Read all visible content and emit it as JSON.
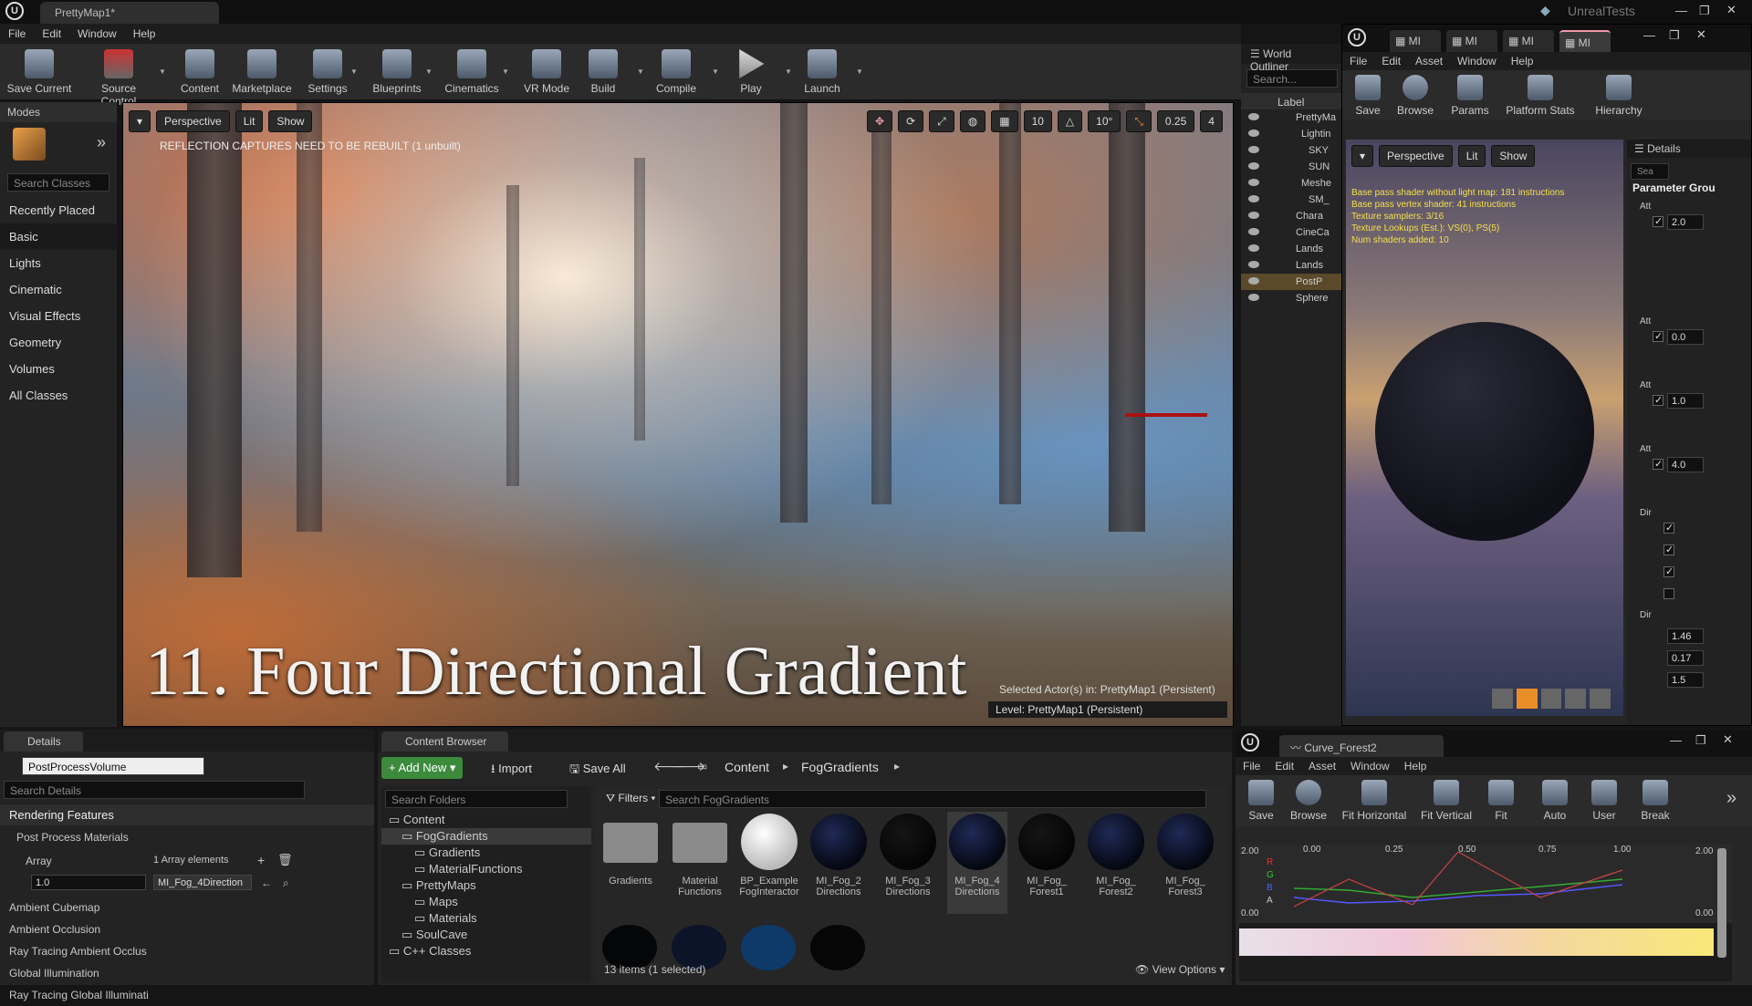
{
  "window": {
    "tab_title": "PrettyMap1*",
    "user": "UnrealTests"
  },
  "menu": [
    "File",
    "Edit",
    "Window",
    "Help"
  ],
  "toolbar": [
    {
      "label": "Save Current",
      "icon": "save-icon"
    },
    {
      "label": "Source Control",
      "icon": "source-control-icon"
    },
    {
      "label": "Content",
      "icon": "content-icon"
    },
    {
      "label": "Marketplace",
      "icon": "marketplace-icon"
    },
    {
      "label": "Settings",
      "icon": "settings-icon"
    },
    {
      "label": "Blueprints",
      "icon": "blueprints-icon"
    },
    {
      "label": "Cinematics",
      "icon": "cinematics-icon"
    },
    {
      "label": "VR Mode",
      "icon": "vr-icon"
    },
    {
      "label": "Build",
      "icon": "build-icon"
    },
    {
      "label": "Compile",
      "icon": "compile-icon"
    },
    {
      "label": "Play",
      "icon": "play-icon"
    },
    {
      "label": "Launch",
      "icon": "launch-icon"
    }
  ],
  "modes": {
    "title": "Modes",
    "search_placeholder": "Search Classes",
    "categories": [
      "Recently Placed",
      "Basic",
      "Lights",
      "Cinematic",
      "Visual Effects",
      "Geometry",
      "Volumes",
      "All Classes"
    ],
    "selected": "Basic"
  },
  "viewport": {
    "perspective": "Perspective",
    "lit": "Lit",
    "show": "Show",
    "warning": "REFLECTION CAPTURES NEED TO BE REBUILT (1 unbuilt)",
    "grid": "10",
    "rotation": "10°",
    "scale": "0.25",
    "camera_speed": "4",
    "selected_actor": "Selected Actor(s) in:  PrettyMap1 (Persistent)",
    "level": "Level:  PrettyMap1 (Persistent)",
    "overlay_title": "11. Four Directional Gradient"
  },
  "outliner": {
    "title": "World Outliner",
    "search_placeholder": "Search...",
    "col": "Label",
    "rows": [
      "PrettyMa",
      "Lightin",
      "SKY",
      "SUN",
      "Meshe",
      "SM_",
      "Chara",
      "CineCa",
      "Lands",
      "Lands",
      "PostP",
      "Sphere"
    ]
  },
  "material": {
    "tabs": [
      "MI",
      "MI",
      "MI",
      "MI"
    ],
    "menu": [
      "File",
      "Edit",
      "Asset",
      "Window",
      "Help"
    ],
    "tools": [
      "Save",
      "Browse",
      "Params",
      "Platform Stats",
      "Hierarchy"
    ],
    "perspective": "Perspective",
    "lit": "Lit",
    "show": "Show",
    "stats": [
      "Base pass shader without light map: 181 instructions",
      "Base pass vertex shader: 41 instructions",
      "Texture samplers: 3/16",
      "Texture Lookups (Est.): VS(0), PS(5)",
      "Num shaders added: 10"
    ],
    "details_title": "Details",
    "search_placeholder": "Sea",
    "param_group": "Parameter Grou",
    "groups": [
      "Att",
      "Att",
      "Att",
      "Att",
      "Dir",
      "Dir"
    ],
    "values": [
      "2.0",
      "0.0",
      "1.0",
      "4.0",
      "1.46",
      "0.17",
      "1.5"
    ]
  },
  "details": {
    "title": "Details",
    "actor": "PostProcessVolume",
    "search_placeholder": "Search Details",
    "section": "Rendering Features",
    "ppm": "Post Process Materials",
    "array": "Array",
    "array_count": "1 Array elements",
    "element_value": "1.0",
    "element_asset": "MI_Fog_4Direction",
    "rows": [
      "Ambient Cubemap",
      "Ambient Occlusion",
      "Ray Tracing Ambient Occlus",
      "Global Illumination",
      "Ray Tracing Global Illuminati"
    ]
  },
  "content_browser": {
    "title": "Content Browser",
    "add_new": "Add New",
    "import": "Import",
    "save_all": "Save All",
    "path": [
      "Content",
      "FogGradients"
    ],
    "search_folders": "Search Folders",
    "filters": "Filters",
    "search_assets": "Search FogGradients",
    "tree": [
      {
        "label": "Content",
        "indent": 0
      },
      {
        "label": "FogGradients",
        "indent": 1
      },
      {
        "label": "Gradients",
        "indent": 2
      },
      {
        "label": "MaterialFunctions",
        "indent": 2
      },
      {
        "label": "PrettyMaps",
        "indent": 1
      },
      {
        "label": "Maps",
        "indent": 2
      },
      {
        "label": "Materials",
        "indent": 2
      },
      {
        "label": "SoulCave",
        "indent": 1
      },
      {
        "label": "C++ Classes",
        "indent": 0
      }
    ],
    "assets": [
      {
        "label": "Gradients",
        "kind": "folder"
      },
      {
        "label": "Material Functions",
        "kind": "folder"
      },
      {
        "label": "BP_Example FogInteractor",
        "kind": "white"
      },
      {
        "label": "MI_Fog_2 Directions",
        "kind": "ball"
      },
      {
        "label": "MI_Fog_3 Directions",
        "kind": "ball"
      },
      {
        "label": "MI_Fog_4 Directions",
        "kind": "ball"
      },
      {
        "label": "MI_Fog_ Forest1",
        "kind": "ball"
      },
      {
        "label": "MI_Fog_ Forest2",
        "kind": "ball"
      },
      {
        "label": "MI_Fog_ Forest3",
        "kind": "ball"
      }
    ],
    "status": "13 items (1 selected)",
    "view_options": "View Options"
  },
  "curve": {
    "tab": "Curve_Forest2",
    "menu": [
      "File",
      "Edit",
      "Asset",
      "Window",
      "Help"
    ],
    "tools": [
      "Save",
      "Browse",
      "Fit Horizontal",
      "Fit Vertical",
      "Fit",
      "Auto",
      "User",
      "Break"
    ],
    "x_ticks": [
      "0.00",
      "0.25",
      "0.50",
      "0.75",
      "1.00"
    ],
    "y_top": "2.00",
    "y_bottom": "0.00",
    "channels": [
      "R",
      "G",
      "B",
      "A"
    ]
  }
}
